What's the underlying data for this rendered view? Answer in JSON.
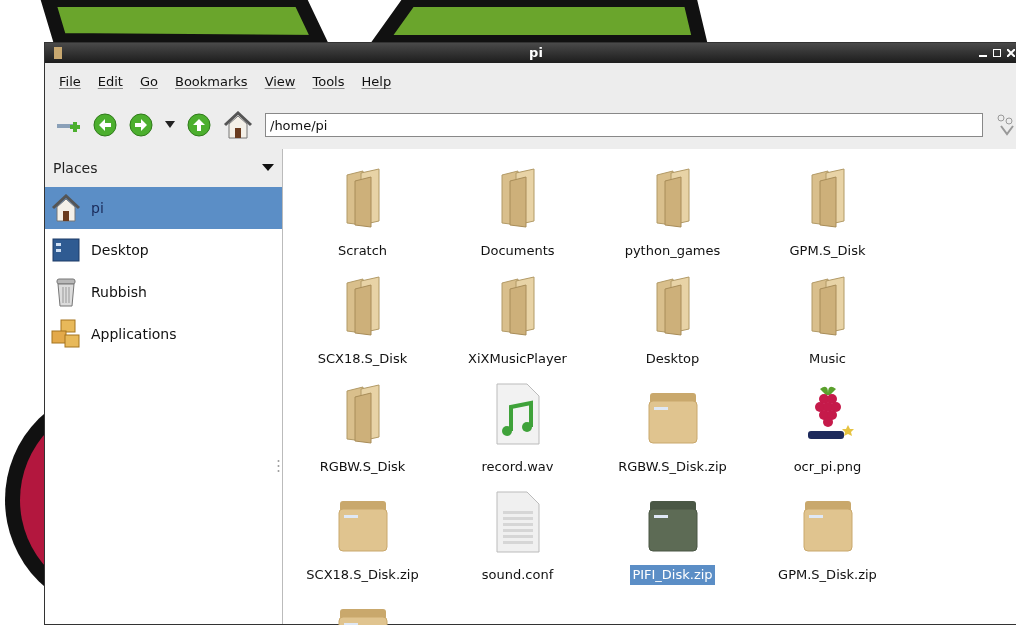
{
  "window": {
    "title": "pi"
  },
  "menu": [
    "File",
    "Edit",
    "Go",
    "Bookmarks",
    "View",
    "Tools",
    "Help"
  ],
  "address": {
    "value": "/home/pi"
  },
  "sidebar": {
    "title": "Places",
    "items": [
      {
        "label": "pi",
        "kind": "home",
        "selected": true
      },
      {
        "label": "Desktop",
        "kind": "desktop",
        "selected": false
      },
      {
        "label": "Rubbish",
        "kind": "trash",
        "selected": false
      },
      {
        "label": "Applications",
        "kind": "applications",
        "selected": false
      }
    ]
  },
  "files": [
    {
      "name": "Scratch",
      "kind": "folder",
      "selected": false
    },
    {
      "name": "Documents",
      "kind": "folder",
      "selected": false
    },
    {
      "name": "python_games",
      "kind": "folder",
      "selected": false
    },
    {
      "name": "GPM.S_Disk",
      "kind": "folder",
      "selected": false
    },
    {
      "name": "SCX18.S_Disk",
      "kind": "folder",
      "selected": false
    },
    {
      "name": "XiXMusicPlayer",
      "kind": "folder",
      "selected": false
    },
    {
      "name": "Desktop",
      "kind": "folder",
      "selected": false
    },
    {
      "name": "Music",
      "kind": "folder",
      "selected": false
    },
    {
      "name": "RGBW.S_Disk",
      "kind": "folder",
      "selected": false
    },
    {
      "name": "record.wav",
      "kind": "audio",
      "selected": false
    },
    {
      "name": "RGBW.S_Disk.zip",
      "kind": "archive",
      "selected": false
    },
    {
      "name": "ocr_pi.png",
      "kind": "image",
      "selected": false
    },
    {
      "name": "SCX18.S_Disk.zip",
      "kind": "archive",
      "selected": false
    },
    {
      "name": "sound.conf",
      "kind": "text",
      "selected": false
    },
    {
      "name": "PIFI_Disk.zip",
      "kind": "archive",
      "selected": true
    },
    {
      "name": "GPM.S_Disk.zip",
      "kind": "archive",
      "selected": false
    },
    {
      "kind": "archive",
      "selected": false
    }
  ]
}
